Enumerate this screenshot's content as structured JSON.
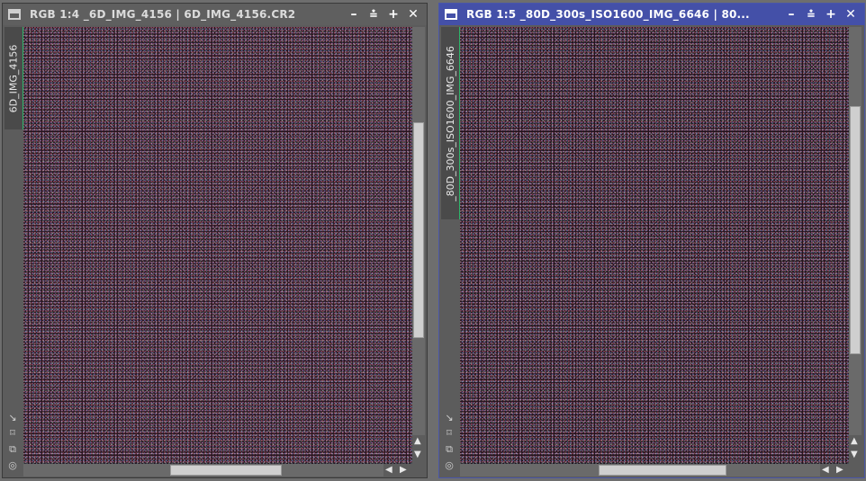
{
  "window1": {
    "title": "RGB 1:4 _6D_IMG_4156 | 6D_IMG_4156.CR2",
    "tab_label": "6D_IMG_4156",
    "buttons": {
      "minimize": "–",
      "shade": "⩮",
      "maximize": "+",
      "close": "✕"
    }
  },
  "window2": {
    "title": "RGB 1:5 _80D_300s_ISO1600_IMG_6646 | 80...",
    "tab_label": "_80D_300s_ISO1600_IMG_6646",
    "buttons": {
      "minimize": "–",
      "shade": "⩮",
      "maximize": "+",
      "close": "✕"
    }
  },
  "icons": {
    "resize": "↘",
    "fit": "⌑",
    "clone": "⧉",
    "target": "◎",
    "arrow_up": "▲",
    "arrow_down": "▼",
    "arrow_left": "◀",
    "arrow_right": "▶"
  },
  "colors": {
    "active_title": "#4450a8",
    "inactive_title": "#5f5f5f",
    "tab_accent": "#2db36a"
  }
}
